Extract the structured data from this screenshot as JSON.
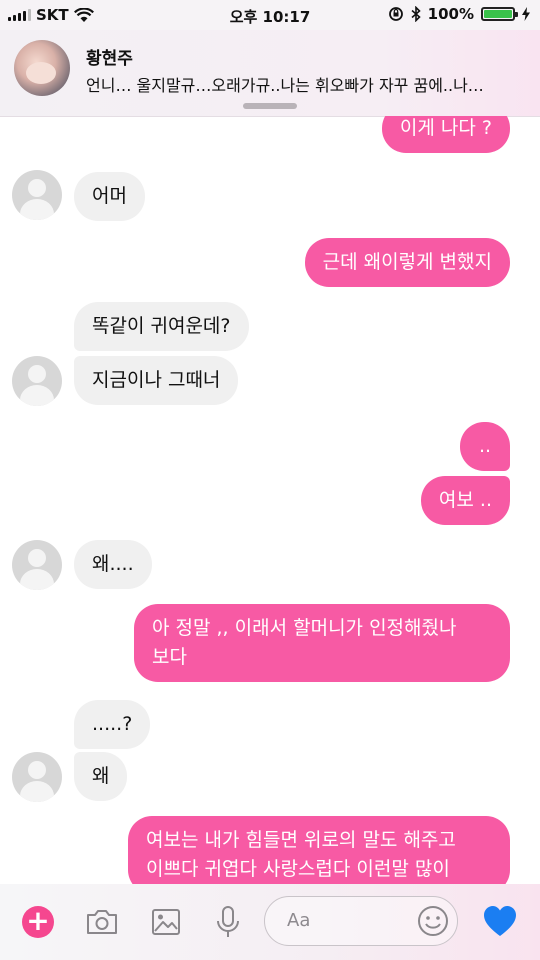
{
  "status_bar": {
    "carrier": "SKT",
    "time": "오후 10:17",
    "battery": "100%",
    "battery_level": 1.0,
    "battery_color": "#39c24a"
  },
  "notification": {
    "sender": "황현주",
    "preview": "언니… 울지말규…오래가규..나는 휘오빠가 자꾸 꿈에..나…"
  },
  "messages": [
    {
      "side": "out",
      "text": "이게 나다 ?"
    },
    {
      "side": "in",
      "text": "어머"
    },
    {
      "side": "out",
      "text": "근데 왜이렇게 변했지"
    },
    {
      "side": "in",
      "text": "똑같이 귀여운데?"
    },
    {
      "side": "in",
      "text": "지금이나 그때너"
    },
    {
      "side": "out",
      "text": ".."
    },
    {
      "side": "out",
      "text": "여보 .."
    },
    {
      "side": "in",
      "text": "왜...."
    },
    {
      "side": "out",
      "text": "아 정말 ,, 이래서 할머니가 인정해줬나\n보다"
    },
    {
      "side": "in",
      "text": ".....?"
    },
    {
      "side": "in",
      "text": "왜"
    },
    {
      "side": "out",
      "text": "여보는 내가 힘들면 위로의 말도 해주고\n이쁘다 귀엽다 사랑스럽다 이런말 많이"
    }
  ],
  "composer": {
    "placeholder": "Aa"
  },
  "colors": {
    "outgoing_bubble": "#f75aa4",
    "incoming_bubble": "#f0f0f0",
    "accent": "#f5478f",
    "heart": "#1b7ef2"
  },
  "icons": [
    "plus-icon",
    "camera-icon",
    "gallery-icon",
    "microphone-icon",
    "emoji-icon",
    "heart-icon"
  ]
}
